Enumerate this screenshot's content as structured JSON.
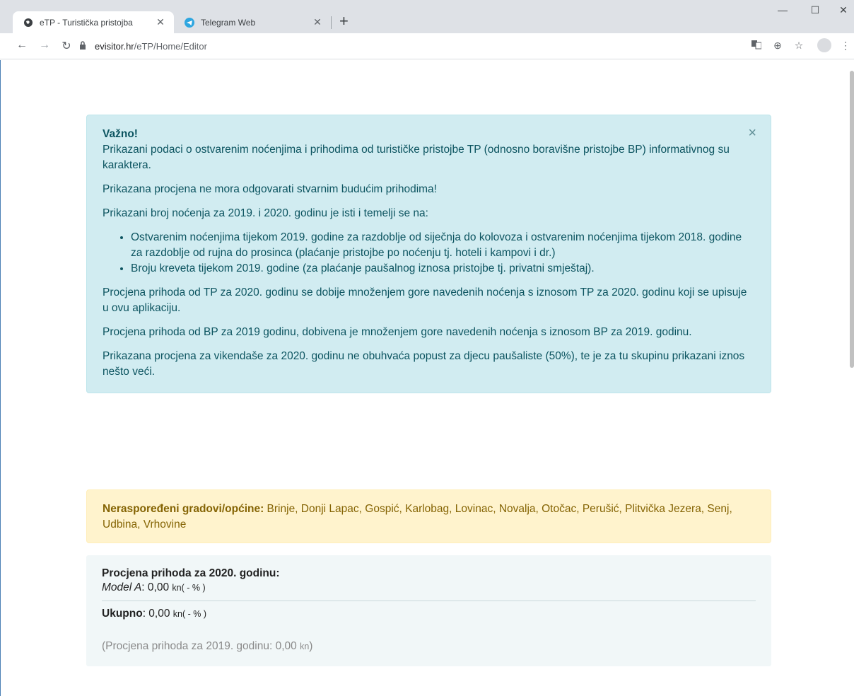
{
  "browser": {
    "tabs": [
      {
        "title": "eTP - Turistička pristojba",
        "active": true,
        "icon": "globe-icon"
      },
      {
        "title": "Telegram Web",
        "active": false,
        "icon": "telegram-icon"
      }
    ],
    "url_host": "evisitor.hr",
    "url_path": "/eTP/Home/Editor"
  },
  "info_alert": {
    "title": "Važno!",
    "p1": "Prikazani podaci o ostvarenim noćenjima i prihodima od turističke pristojbe TP (odnosno boravišne pristojbe BP) informativnog su karaktera.",
    "p2": "Prikazana procjena ne mora odgovarati stvarnim budućim prihodima!",
    "p3": "Prikazani broj noćenja za 2019. i 2020. godinu je isti i temelji se na:",
    "bullets": [
      "Ostvarenim noćenjima tijekom 2019. godine za razdoblje od siječnja do kolovoza i ostvarenim noćenjima tijekom 2018. godine za razdoblje od rujna do prosinca (plaćanje pristojbe po noćenju tj. hoteli i kampovi i dr.)",
      "Broju kreveta tijekom 2019. godine (za plaćanje paušalnog iznosa pristojbe tj. privatni smještaj)."
    ],
    "p4": "Procjena prihoda od TP za 2020. godinu se dobije množenjem gore navedenih noćenja s iznosom TP za 2020. godinu koji se upisuje u ovu aplikaciju.",
    "p5": "Procjena prihoda od BP za 2019 godinu, dobivena je množenjem gore navedenih noćenja s iznosom BP za 2019. godinu.",
    "p6": "Prikazana procjena za vikendaše za 2020. godinu ne obuhvaća popust za djecu paušaliste (50%), te je za tu skupinu prikazani iznos nešto veći.",
    "close": "×"
  },
  "warning_alert": {
    "label": "Neraspoređeni gradovi/općine:",
    "text": " Brinje, Donji Lapac, Gospić, Karlobag, Lovinac, Novalja, Otočac, Perušić, Plitvička Jezera, Senj, Udbina, Vrhovine"
  },
  "summary": {
    "title": "Procjena prihoda za 2020. godinu:",
    "model_label": "Model A",
    "model_value": ": 0,00 ",
    "currency": "kn",
    "pct": "( - % )",
    "total_label": "Ukupno",
    "total_value": ": 0,00 ",
    "prev_text": "(Procjena prihoda za 2019. godinu: 0,00 ",
    "prev_close": ")"
  }
}
